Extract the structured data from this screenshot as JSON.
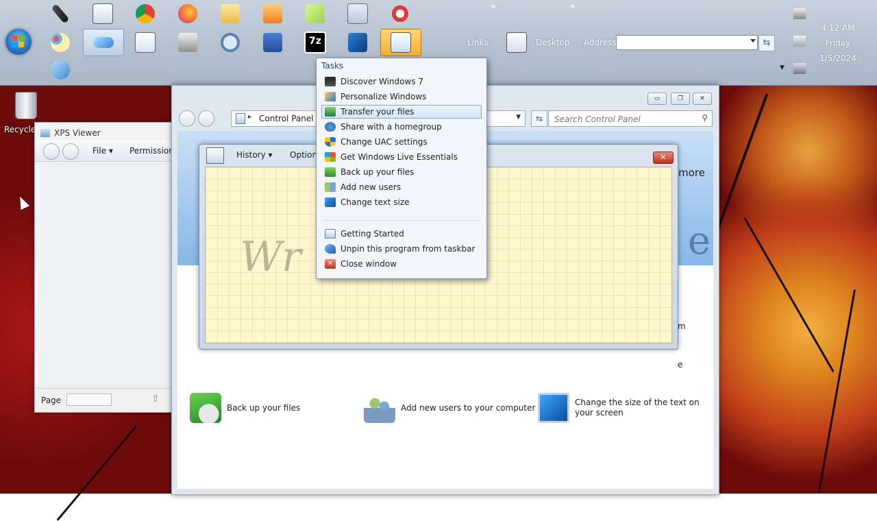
{
  "taskbar": {
    "links_label": "Links",
    "desktop_label": "Desktop",
    "address_label": "Address",
    "address_value": "",
    "chevron": "»"
  },
  "clock": {
    "time": "4:12 AM",
    "day": "Friday",
    "date": "1/5/2024"
  },
  "desktop": {
    "recycle_label": "Recycle"
  },
  "xps_viewer": {
    "title": "XPS Viewer",
    "file_menu": "File ▾",
    "permissions_menu": "Permissions",
    "page_label": "Page"
  },
  "control_panel": {
    "breadcrumb": "Control Panel",
    "search_placeholder": "Search Control Panel",
    "banner_more": "more",
    "banner_letter": "e",
    "items": [
      {
        "label": "Back up your files"
      },
      {
        "label": "Add new users to your computer"
      },
      {
        "label": "Change the size of the text on your screen"
      }
    ],
    "partial_m": "m",
    "partial_e": "e"
  },
  "math_input_panel": {
    "history_menu": "History ▾",
    "options_menu": "Option",
    "watermark": "Write math here",
    "watermark_visible": "Wr        th here"
  },
  "jump_list": {
    "tasks_header": "Tasks",
    "tasks": [
      {
        "label": "Discover Windows 7",
        "icon": "monitor-icon"
      },
      {
        "label": "Personalize Windows",
        "icon": "personalize-icon"
      },
      {
        "label": "Transfer your files",
        "icon": "transfer-icon",
        "highlighted": true
      },
      {
        "label": "Share with a homegroup",
        "icon": "homegroup-icon"
      },
      {
        "label": "Change UAC settings",
        "icon": "uac-shield-icon"
      },
      {
        "label": "Get Windows Live Essentials",
        "icon": "windows-flag-icon"
      },
      {
        "label": "Back up your files",
        "icon": "backup-icon"
      },
      {
        "label": "Add new users",
        "icon": "users-icon"
      },
      {
        "label": "Change text size",
        "icon": "display-icon"
      }
    ],
    "actions": [
      {
        "label": "Getting Started",
        "icon": "getting-started-icon"
      },
      {
        "label": "Unpin this program from taskbar",
        "icon": "unpin-icon"
      },
      {
        "label": "Close window",
        "icon": "close-window-icon"
      }
    ]
  },
  "colors": {
    "taskbar": "#b6c2d0",
    "highlight": "#d5e6fa",
    "math_canvas": "#fff8cf"
  }
}
